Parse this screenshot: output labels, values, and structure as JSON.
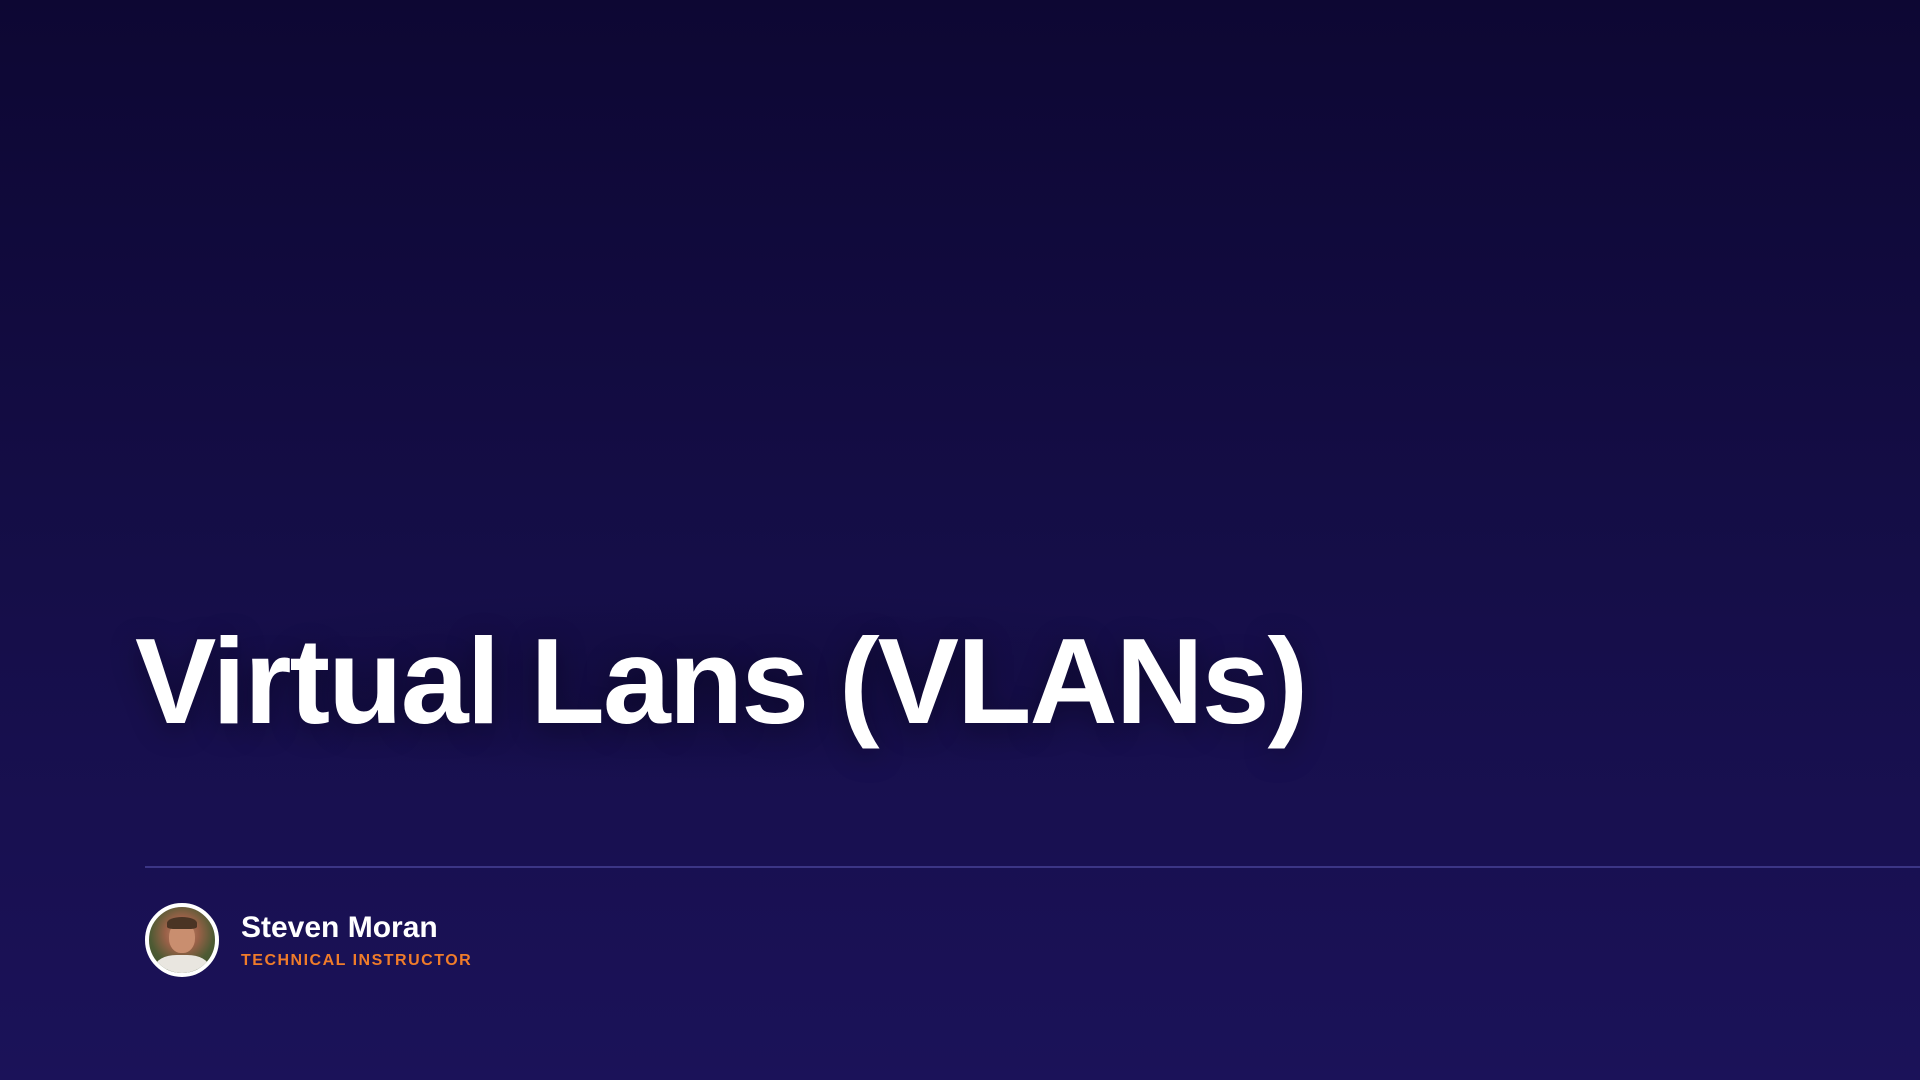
{
  "slide": {
    "title": "Virtual Lans (VLANs)"
  },
  "presenter": {
    "name": "Steven Moran",
    "role": "TECHNICAL INSTRUCTOR"
  },
  "colors": {
    "background_top": "#0d0733",
    "background_bottom": "#1b1259",
    "title": "#ffffff",
    "accent": "#f07c2a",
    "divider": "#3b3585"
  }
}
